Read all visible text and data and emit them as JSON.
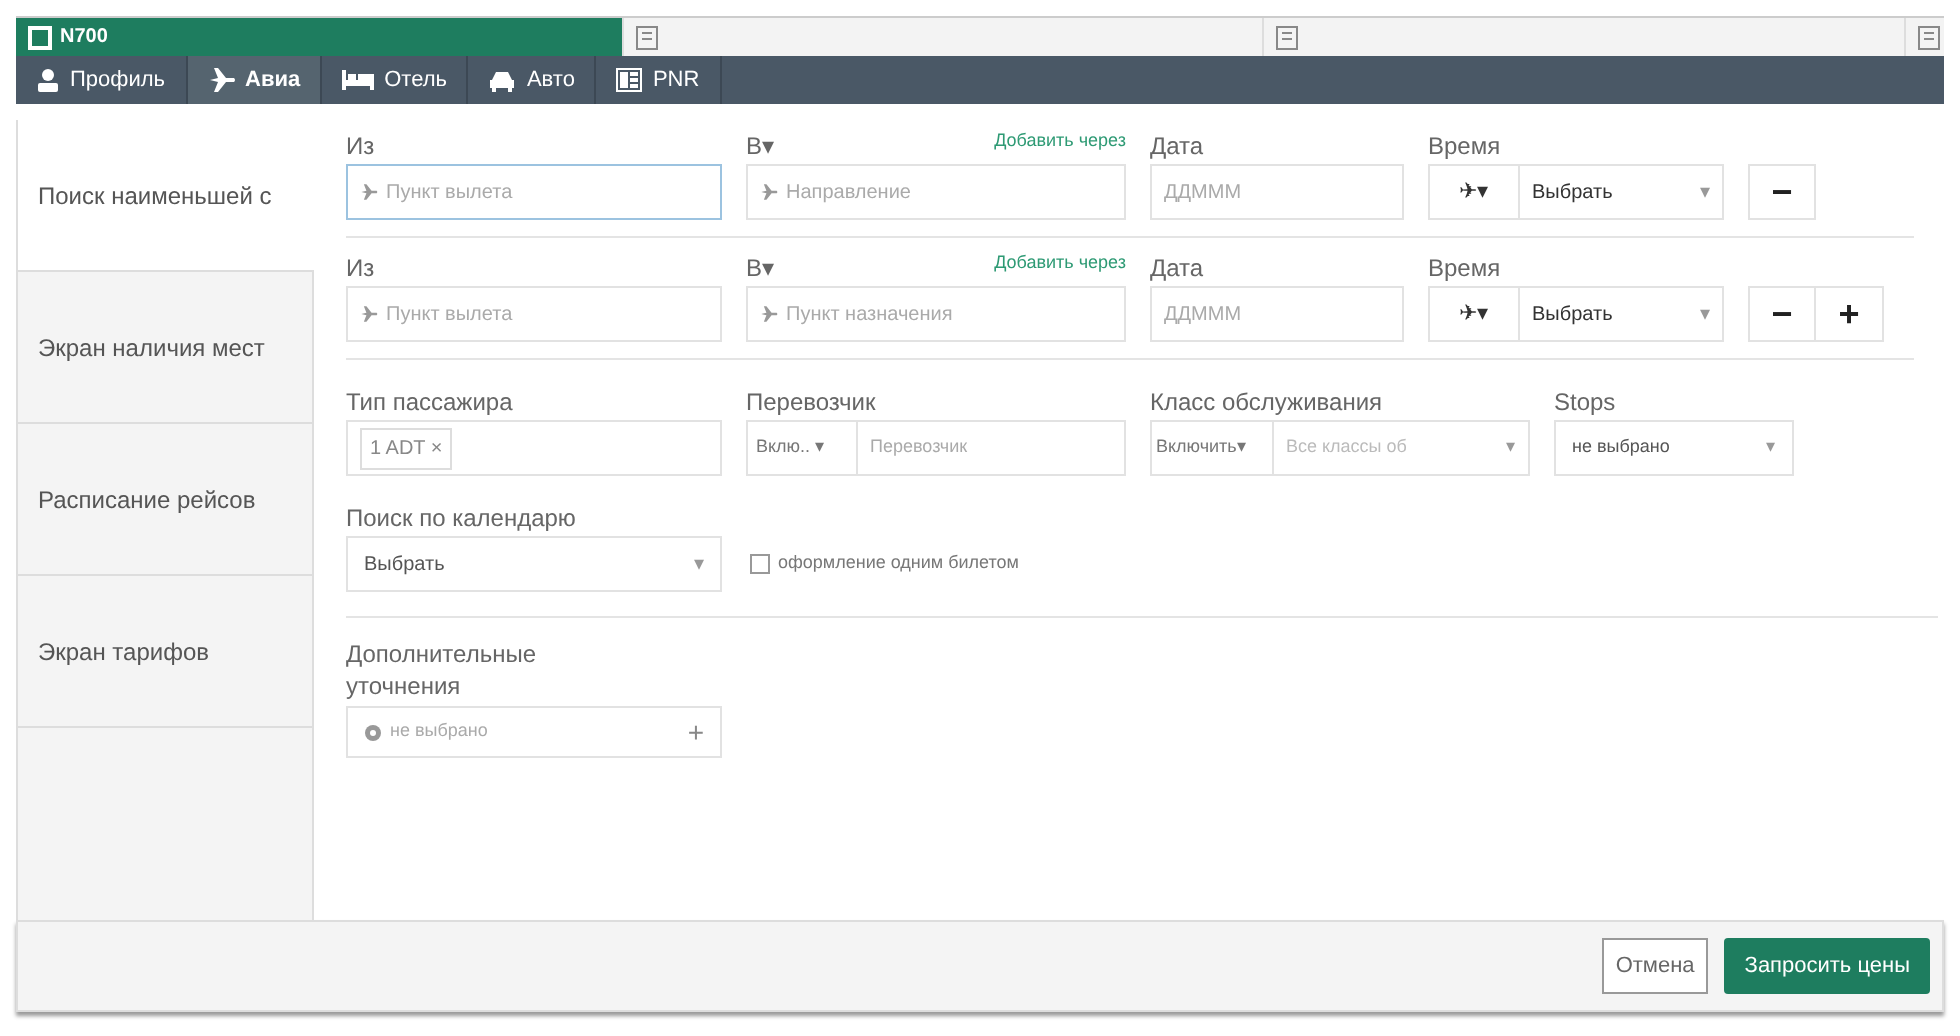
{
  "window_tabs": [
    {
      "label": "N700",
      "selected": true
    },
    {
      "selected": false
    },
    {
      "selected": false
    },
    {
      "selected": false
    }
  ],
  "nav": [
    {
      "label": "Профиль",
      "kind": "user",
      "selected": false
    },
    {
      "label": "Авиа",
      "kind": "plane",
      "selected": true
    },
    {
      "label": "Отель",
      "kind": "bed",
      "selected": false
    },
    {
      "label": "Авто",
      "kind": "car",
      "selected": false
    },
    {
      "label": "PNR",
      "kind": "doc",
      "selected": false
    }
  ],
  "sidebar": [
    {
      "label": "Поиск наименьшей с",
      "selected": true
    },
    {
      "label": "Экран наличия мест",
      "selected": false
    },
    {
      "label": "Расписание рейсов",
      "selected": false
    },
    {
      "label": "Экран тарифов",
      "selected": false
    }
  ],
  "segments": [
    {
      "from_label": "Из",
      "from_placeholder": "Пункт вылета",
      "from_focused": true,
      "to_label": "В▾",
      "add_via": "Добавить через",
      "to_placeholder": "Направление",
      "date_label": "Дата",
      "date_placeholder": "ДДМММ",
      "time_label": "Время",
      "time_mode": "✈▾",
      "time_value": "Выбрать",
      "time_caret": "▾",
      "remove": "−"
    },
    {
      "from_label": "Из",
      "from_placeholder": "Пункт вылета",
      "from_focused": false,
      "to_label": "В▾",
      "add_via": "Добавить через",
      "to_placeholder": "Пункт назначения",
      "date_label": "Дата",
      "date_placeholder": "ДДМММ",
      "time_label": "Время",
      "time_mode": "✈▾",
      "time_value": "Выбрать",
      "time_caret": "▾",
      "remove": "−",
      "add": "+"
    }
  ],
  "passenger": {
    "label": "Тип пассажира",
    "chip": "1 ADT ×"
  },
  "carrier": {
    "label": "Перевозчик",
    "mode": "Вклю.. ▾",
    "placeholder": "Перевозчик"
  },
  "cabin": {
    "label": "Класс обслуживания",
    "mode": "Включить▾",
    "placeholder": "Все классы об",
    "caret": "▾"
  },
  "stops": {
    "label": "Stops",
    "value": "не выбрано",
    "caret": "▾"
  },
  "calendar": {
    "label": "Поиск по календарю",
    "value": "Выбрать",
    "caret": "▾"
  },
  "single_ticket": {
    "label": "оформление одним билетом",
    "checked": false
  },
  "extra": {
    "label": "Дополнительные уточнения",
    "placeholder": "не выбрано",
    "add": "+"
  },
  "buttons": [
    {
      "label": "Отмена",
      "kind": "secondary"
    },
    {
      "label": "Запросить цены",
      "kind": "primary"
    }
  ]
}
